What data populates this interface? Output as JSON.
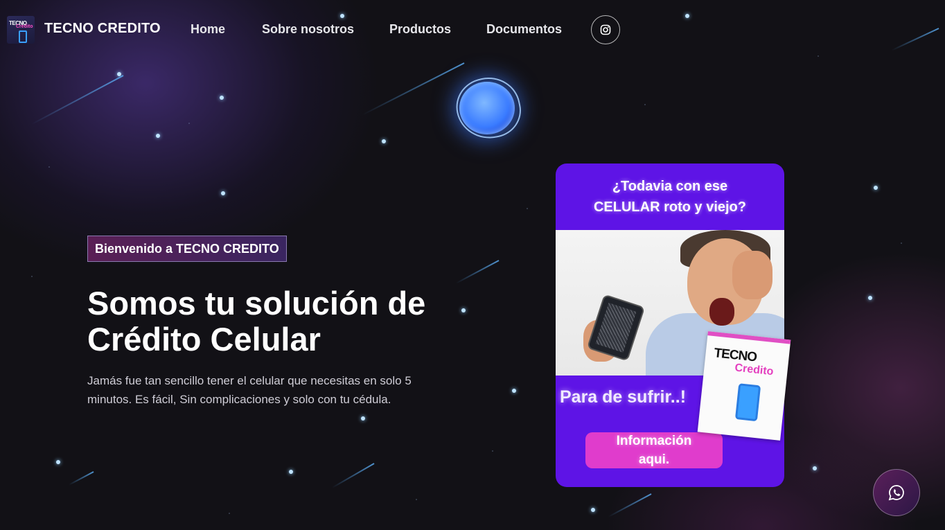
{
  "header": {
    "brand": "TECNO CREDITO",
    "logo_text_top": "TECNO",
    "logo_text_bottom": "Credito",
    "nav": [
      "Home",
      "Sobre nosotros",
      "Productos",
      "Documentos"
    ],
    "social_icon": "instagram-icon"
  },
  "hero": {
    "badge": "Bienvenido a TECNO CREDITO",
    "title_line1": "Somos tu solución de",
    "title_line2": "Crédito Celular",
    "description": "Jamás fue tan sencillo tener el celular que necesitas en solo 5 minutos. Es fácil, Sin complicaciones y solo con tu cédula."
  },
  "ad": {
    "question_line1": "¿Todavia con ese",
    "question_line2": "CELULAR roto y viejo?",
    "sticker_line1": "TECNO",
    "sticker_line2": "Credito",
    "slogan": "Para de sufrir..!",
    "cta_line1": "Información",
    "cta_line2": "aqui."
  },
  "floating": {
    "whatsapp_icon": "whatsapp-icon"
  },
  "colors": {
    "background": "#121116",
    "ad_purple": "#5e14e6",
    "cta_pink": "#e03ccc",
    "star_blue": "#bfe3ff"
  }
}
